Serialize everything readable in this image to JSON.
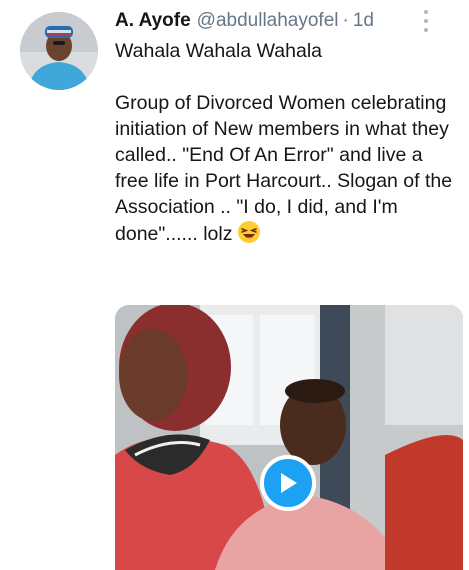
{
  "tweet": {
    "author_name": "A. Ayofe",
    "handle": "@abdullahayofel",
    "separator": "·",
    "timestamp": "1d",
    "text_line1": "Wahala Wahala Wahala",
    "text_body": "Group of Divorced Women celebrating initiation of New members in what they called.. \"End Of An Error\" and live a free life in Port Harcourt.. Slogan of the Association .. \"I do, I did, and I'm done\"...... lolz",
    "emoji": "laughing-face"
  },
  "icons": {
    "more": "more-vertical-icon",
    "play": "play-icon"
  },
  "colors": {
    "text": "#14171a",
    "muted": "#657786",
    "accent": "#1da1f2"
  }
}
